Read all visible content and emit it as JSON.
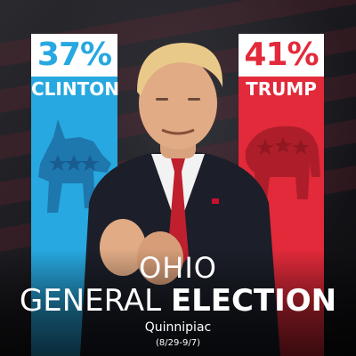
{
  "candidates": {
    "left": {
      "name": "CLINTON",
      "percent": "37%",
      "color": "#27a8e0",
      "mascot": "donkey-icon"
    },
    "right": {
      "name": "TRUMP",
      "percent": "41%",
      "color": "#e22a3a",
      "mascot": "elephant-icon"
    }
  },
  "title": {
    "state": "OHIO",
    "line_light": "GENERAL ",
    "line_bold": "ELECTION"
  },
  "pollster": "Quinnipiac",
  "dates": "(8/29-9/7)"
}
